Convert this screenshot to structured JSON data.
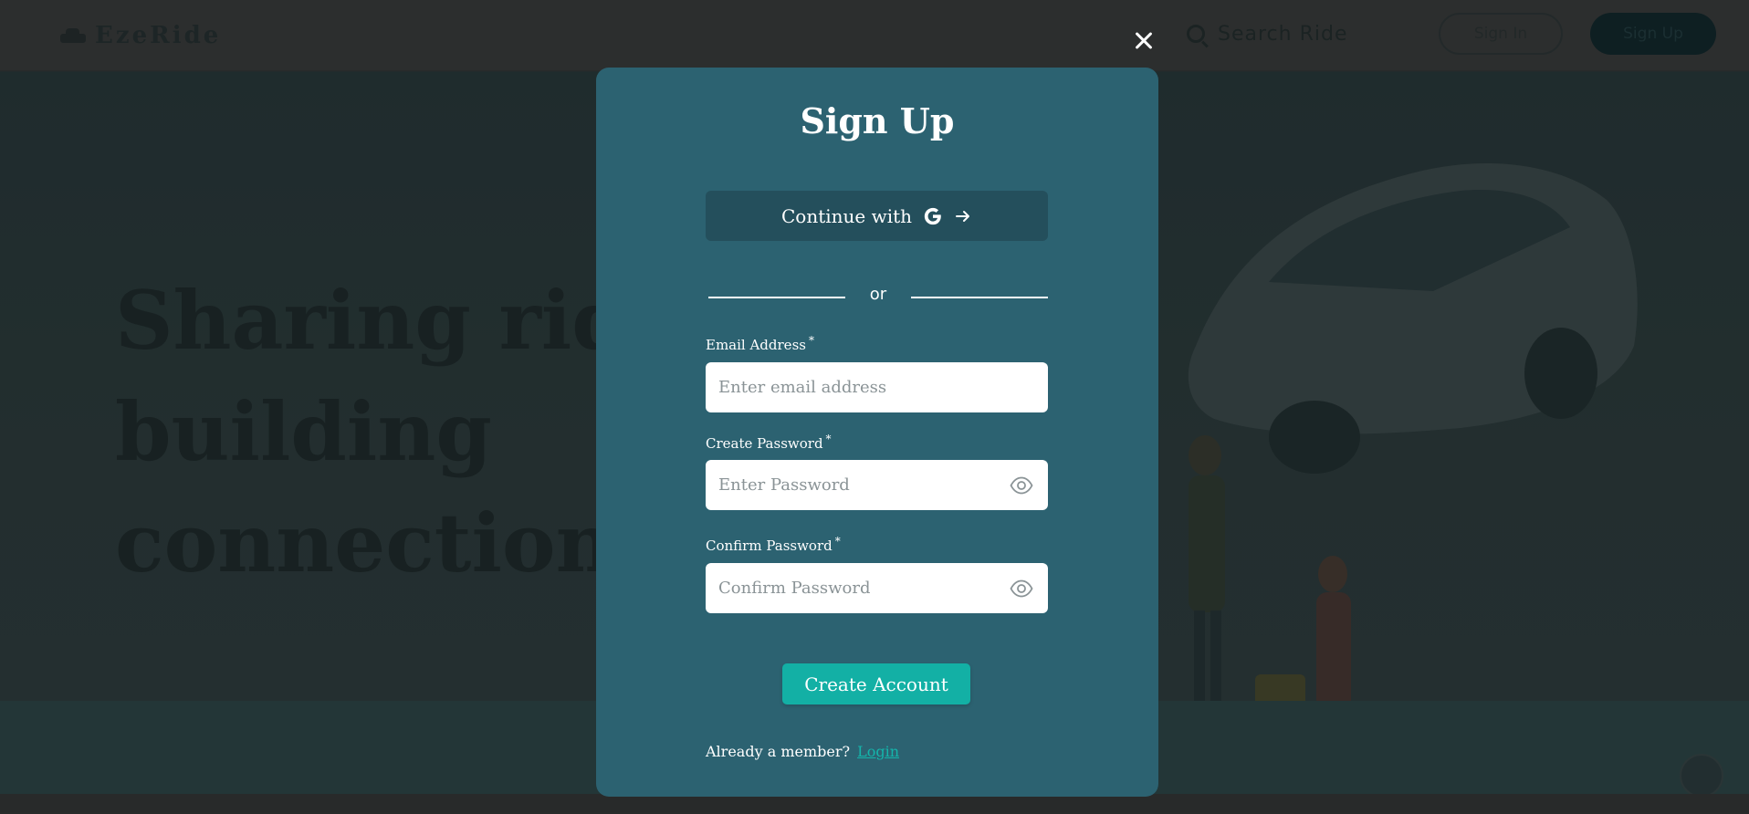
{
  "background": {
    "logo_text": "EzeRide",
    "search_placeholder": "Search Ride",
    "signin_label": "Sign In",
    "signup_label": "Sign Up",
    "hero_title_lines": [
      "Sharing rides,",
      "building",
      "connections"
    ]
  },
  "modal": {
    "title": "Sign Up",
    "google_button_label": "Continue with",
    "divider_text": "or",
    "fields": {
      "email": {
        "label": "Email Address",
        "required_mark": "*",
        "placeholder": "Enter email address",
        "value": ""
      },
      "password": {
        "label": "Create Password",
        "required_mark": "*",
        "placeholder": "Enter Password",
        "value": ""
      },
      "confirm": {
        "label": "Confirm Password",
        "required_mark": "*",
        "placeholder": "Confirm Password",
        "value": ""
      }
    },
    "submit_label": "Create Account",
    "member_prompt": "Already a member?",
    "login_link": "Login"
  },
  "icons": {
    "close": "close-icon",
    "google": "google-icon",
    "arrow": "arrow-right-icon",
    "eye": "eye-icon"
  },
  "colors": {
    "modal_bg": "#2c6271",
    "google_btn_bg": "#244f5c",
    "primary_button": "#13b0a5",
    "link": "#14b5ab",
    "overlay_dark": "#2a3537"
  }
}
